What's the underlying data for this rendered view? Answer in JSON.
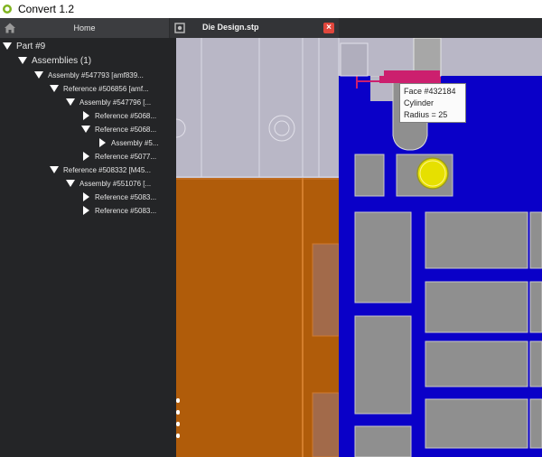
{
  "app": {
    "title": "Convert 1.2"
  },
  "tabs": {
    "home_label": "Home",
    "design_label": "Die Design.stp"
  },
  "tree": {
    "part": "Part #9",
    "assemblies": "Assemblies (1)",
    "n1": "Assembly #547793 [amf839...",
    "n2": "Reference #506856 [amf...",
    "n3": "Assembly #547796 [...",
    "n4": "Reference #5068...",
    "n5": "Reference #5068...",
    "n6": "Assembly #5...",
    "n7": "Reference #5077...",
    "n8": "Reference #508332 [M45...",
    "n9": "Assembly #551076 [...",
    "n10": "Reference #5083...",
    "n11": "Reference #5083..."
  },
  "tooltip": {
    "face": "Face #432184",
    "type": "Cylinder",
    "radius": "Radius = 25"
  },
  "colors": {
    "viewport_bg": "#b9b7c6",
    "orange_plate": "#b05c0a",
    "blue_plate": "#0a00c8",
    "gray_block": "#8f8f8f",
    "highlight_yellow": "#e6e000",
    "magenta_pin": "#cc1f6e"
  },
  "icons": [
    "app-logo-icon",
    "home-icon",
    "gear-icon",
    "close-icon",
    "expand-triangle-icon",
    "collapse-triangle-icon"
  ]
}
